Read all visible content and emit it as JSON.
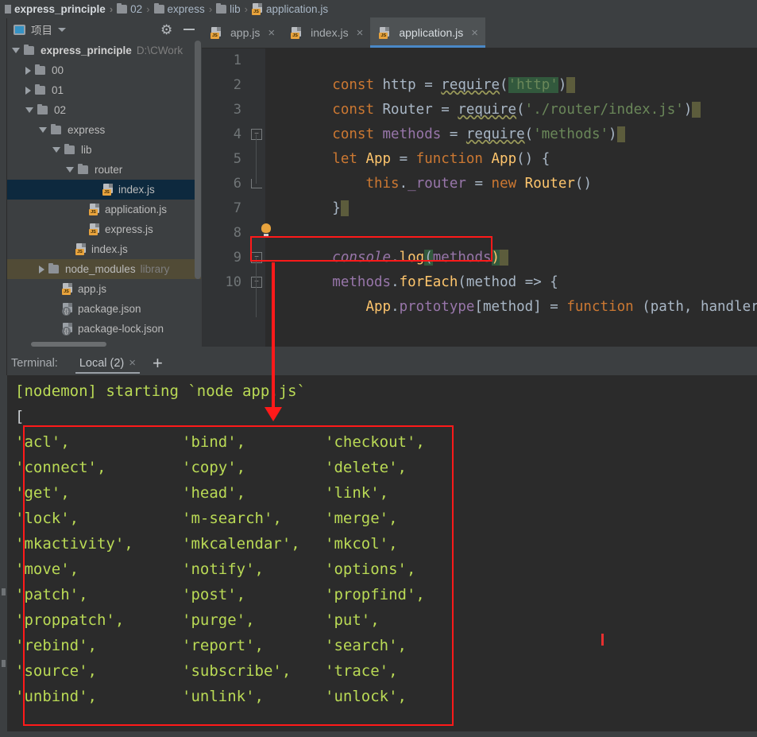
{
  "breadcrumb": {
    "items": [
      {
        "label": "express_principle",
        "icon": "folder-icon"
      },
      {
        "label": "02",
        "icon": "folder-icon"
      },
      {
        "label": "express",
        "icon": "folder-icon"
      },
      {
        "label": "lib",
        "icon": "folder-icon"
      },
      {
        "label": "application.js",
        "icon": "js-file-icon"
      }
    ],
    "separator": "›"
  },
  "project_panel": {
    "title": "项目",
    "window_icon": "project-window-icon",
    "caret_icon": "chevron-down-icon",
    "settings_icon": "gear-icon",
    "minimize_icon": "minimize-icon",
    "tree": [
      {
        "label": "express_principle",
        "hint": "D:\\CWork",
        "depth": 0,
        "toggle": "open",
        "icon": "folder-icon",
        "bold": true,
        "state": "normal"
      },
      {
        "label": "00",
        "hint": "",
        "depth": 1,
        "toggle": "closed",
        "icon": "folder-icon",
        "bold": false,
        "state": "normal"
      },
      {
        "label": "01",
        "hint": "",
        "depth": 1,
        "toggle": "closed",
        "icon": "folder-icon",
        "bold": false,
        "state": "normal"
      },
      {
        "label": "02",
        "hint": "",
        "depth": 1,
        "toggle": "open",
        "icon": "folder-icon",
        "bold": false,
        "state": "normal"
      },
      {
        "label": "express",
        "hint": "",
        "depth": 2,
        "toggle": "open",
        "icon": "folder-icon",
        "bold": false,
        "state": "normal"
      },
      {
        "label": "lib",
        "hint": "",
        "depth": 3,
        "toggle": "open",
        "icon": "folder-icon",
        "bold": false,
        "state": "normal"
      },
      {
        "label": "router",
        "hint": "",
        "depth": 4,
        "toggle": "open",
        "icon": "folder-icon",
        "bold": false,
        "state": "normal"
      },
      {
        "label": "index.js",
        "hint": "",
        "depth": 6,
        "toggle": "none",
        "icon": "js-file-icon",
        "bold": false,
        "state": "selected"
      },
      {
        "label": "application.js",
        "hint": "",
        "depth": 5,
        "toggle": "none",
        "icon": "js-file-icon",
        "bold": false,
        "state": "normal"
      },
      {
        "label": "express.js",
        "hint": "",
        "depth": 5,
        "toggle": "none",
        "icon": "js-file-icon",
        "bold": false,
        "state": "normal"
      },
      {
        "label": "index.js",
        "hint": "",
        "depth": 4,
        "toggle": "none",
        "icon": "js-file-icon",
        "bold": false,
        "state": "normal"
      },
      {
        "label": "node_modules",
        "hint": "library",
        "depth": 2,
        "toggle": "closed",
        "icon": "folder-icon",
        "bold": false,
        "state": "library"
      },
      {
        "label": "app.js",
        "hint": "",
        "depth": 3,
        "toggle": "none",
        "icon": "js-file-icon",
        "bold": false,
        "state": "normal"
      },
      {
        "label": "package.json",
        "hint": "",
        "depth": 3,
        "toggle": "none",
        "icon": "json-file-icon",
        "bold": false,
        "state": "normal"
      },
      {
        "label": "package-lock.json",
        "hint": "",
        "depth": 3,
        "toggle": "none",
        "icon": "json-file-icon",
        "bold": false,
        "state": "normal"
      }
    ]
  },
  "editor": {
    "tabs": [
      {
        "label": "app.js",
        "icon": "js-file-icon",
        "close": "×",
        "active": false
      },
      {
        "label": "index.js",
        "icon": "js-file-icon",
        "close": "×",
        "active": false
      },
      {
        "label": "application.js",
        "icon": "js-file-icon",
        "close": "×",
        "active": true
      }
    ],
    "line_numbers": [
      "1",
      "2",
      "3",
      "4",
      "5",
      "6",
      "7",
      "8",
      "9",
      "10"
    ],
    "lines": [
      "const http = require('http')",
      "const Router = require('./router/index.js')",
      "const methods = require('methods')",
      "let App = function App() {",
      "    this._router = new Router()",
      "}",
      "",
      "    console.log(methods)",
      "methods.forEach(method => {",
      "    App.prototype[method] = function (path, handler"
    ]
  },
  "terminal": {
    "label": "Terminal:",
    "tabs": [
      {
        "label": "Local (2)",
        "close": "×",
        "active": true
      }
    ],
    "add_icon": "plus-icon",
    "output_header": [
      "[nodemon] starting `node app.js`",
      "["
    ],
    "methods_rows": [
      [
        "'acl',",
        "'bind',",
        "'checkout',"
      ],
      [
        "'connect',",
        "'copy',",
        "'delete',"
      ],
      [
        "'get',",
        "'head',",
        "'link',"
      ],
      [
        "'lock',",
        "'m-search',",
        "'merge',"
      ],
      [
        "'mkactivity',",
        "'mkcalendar',",
        "'mkcol',"
      ],
      [
        "'move',",
        "'notify',",
        "'options',"
      ],
      [
        "'patch',",
        "'post',",
        "'propfind',"
      ],
      [
        "'proppatch',",
        "'purge',",
        "'put',"
      ],
      [
        "'rebind',",
        "'report',",
        "'search',"
      ],
      [
        "'source',",
        "'subscribe',",
        "'trace',"
      ],
      [
        "'unbind',",
        "'unlink',",
        "'unlock',"
      ]
    ]
  },
  "annotations": {
    "highlight_color": "#ff1a1a",
    "code_box": "console.log(methods)",
    "output_box": "methods array printed in terminal"
  },
  "colors": {
    "editor_bg": "#2b2b2b",
    "panel_bg": "#3c3f41",
    "accent_tab": "#4a88c7",
    "selection": "#0d293e",
    "library_row": "#514b36",
    "terminal_text": "#bada55",
    "annotation_red": "#ff1a1a"
  }
}
